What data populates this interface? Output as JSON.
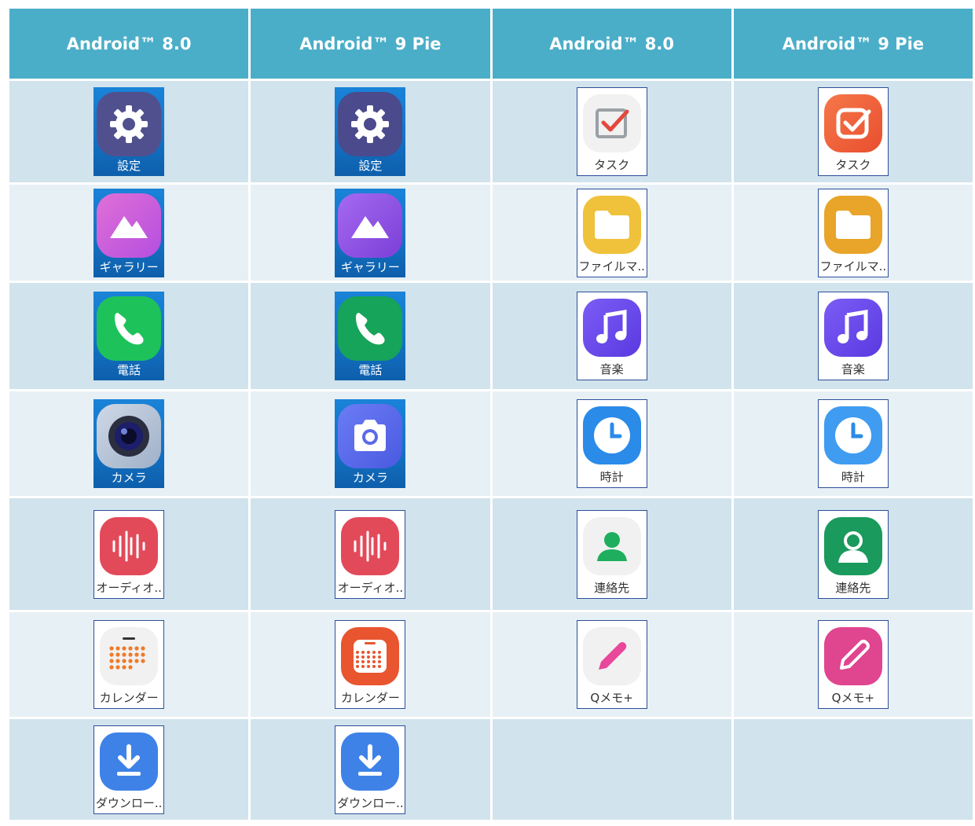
{
  "headers": [
    "Android™ 8.0",
    "Android™ 9 Pie",
    "Android™ 8.0",
    "Android™ 9 Pie"
  ],
  "rows": [
    [
      {
        "icon": "settings-gear-icon",
        "label": "設定",
        "style": "blue",
        "variant": "v8"
      },
      {
        "icon": "settings-gear-icon",
        "label": "設定",
        "style": "blue",
        "variant": "v9"
      },
      {
        "icon": "task-check-icon",
        "label": "タスク",
        "style": "white",
        "variant": "v8"
      },
      {
        "icon": "task-check-icon",
        "label": "タスク",
        "style": "white",
        "variant": "v9"
      }
    ],
    [
      {
        "icon": "gallery-mountain-icon",
        "label": "ギャラリー",
        "style": "blue",
        "variant": "v8"
      },
      {
        "icon": "gallery-mountain-icon",
        "label": "ギャラリー",
        "style": "blue",
        "variant": "v9"
      },
      {
        "icon": "folder-icon",
        "label": "ファイルマ..",
        "style": "white",
        "variant": "v8"
      },
      {
        "icon": "folder-icon",
        "label": "ファイルマ..",
        "style": "white",
        "variant": "v9"
      }
    ],
    [
      {
        "icon": "phone-handset-icon",
        "label": "電話",
        "style": "blue",
        "variant": "v8"
      },
      {
        "icon": "phone-handset-icon",
        "label": "電話",
        "style": "blue",
        "variant": "v9"
      },
      {
        "icon": "music-note-icon",
        "label": "音楽",
        "style": "white",
        "variant": "v8"
      },
      {
        "icon": "music-note-icon",
        "label": "音楽",
        "style": "white",
        "variant": "v9"
      }
    ],
    [
      {
        "icon": "camera-lens-icon",
        "label": "カメラ",
        "style": "blue",
        "variant": "v8"
      },
      {
        "icon": "camera-icon",
        "label": "カメラ",
        "style": "blue",
        "variant": "v9"
      },
      {
        "icon": "clock-icon",
        "label": "時計",
        "style": "white",
        "variant": "v8"
      },
      {
        "icon": "clock-icon",
        "label": "時計",
        "style": "white",
        "variant": "v9"
      }
    ],
    [
      {
        "icon": "audio-waveform-icon",
        "label": "オーディオ..",
        "style": "white",
        "variant": "v8"
      },
      {
        "icon": "audio-waveform-icon",
        "label": "オーディオ..",
        "style": "white",
        "variant": "v9"
      },
      {
        "icon": "contact-person-icon",
        "label": "連絡先",
        "style": "white",
        "variant": "v8"
      },
      {
        "icon": "contact-person-icon",
        "label": "連絡先",
        "style": "white",
        "variant": "v9"
      }
    ],
    [
      {
        "icon": "calendar-grid-icon",
        "label": "カレンダー",
        "style": "white",
        "variant": "v8"
      },
      {
        "icon": "calendar-grid-icon",
        "label": "カレンダー",
        "style": "white",
        "variant": "v9"
      },
      {
        "icon": "pen-icon",
        "label": "Qメモ+",
        "style": "white",
        "variant": "v8"
      },
      {
        "icon": "pen-icon",
        "label": "Qメモ+",
        "style": "white",
        "variant": "v9"
      }
    ],
    [
      {
        "icon": "download-arrow-icon",
        "label": "ダウンロー..",
        "style": "white",
        "variant": "v8"
      },
      {
        "icon": "download-arrow-icon",
        "label": "ダウンロー..",
        "style": "white",
        "variant": "v9"
      },
      null,
      null
    ]
  ],
  "colors": {
    "header_bg": "#4baec8",
    "row_odd": "#d1e3ec",
    "row_even": "#e7f0f5",
    "tile_blue": "#1577cb",
    "tile_border": "#2c4f99"
  }
}
